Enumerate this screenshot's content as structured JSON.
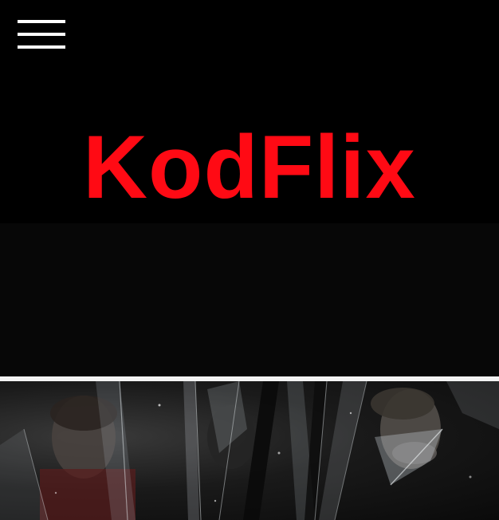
{
  "header": {
    "menu_icon": "hamburger-menu-icon",
    "logo_text": "KodFlix",
    "logo_color": "#ff0a14"
  },
  "banner": {
    "image": "shattered-glass-movie-poster"
  }
}
